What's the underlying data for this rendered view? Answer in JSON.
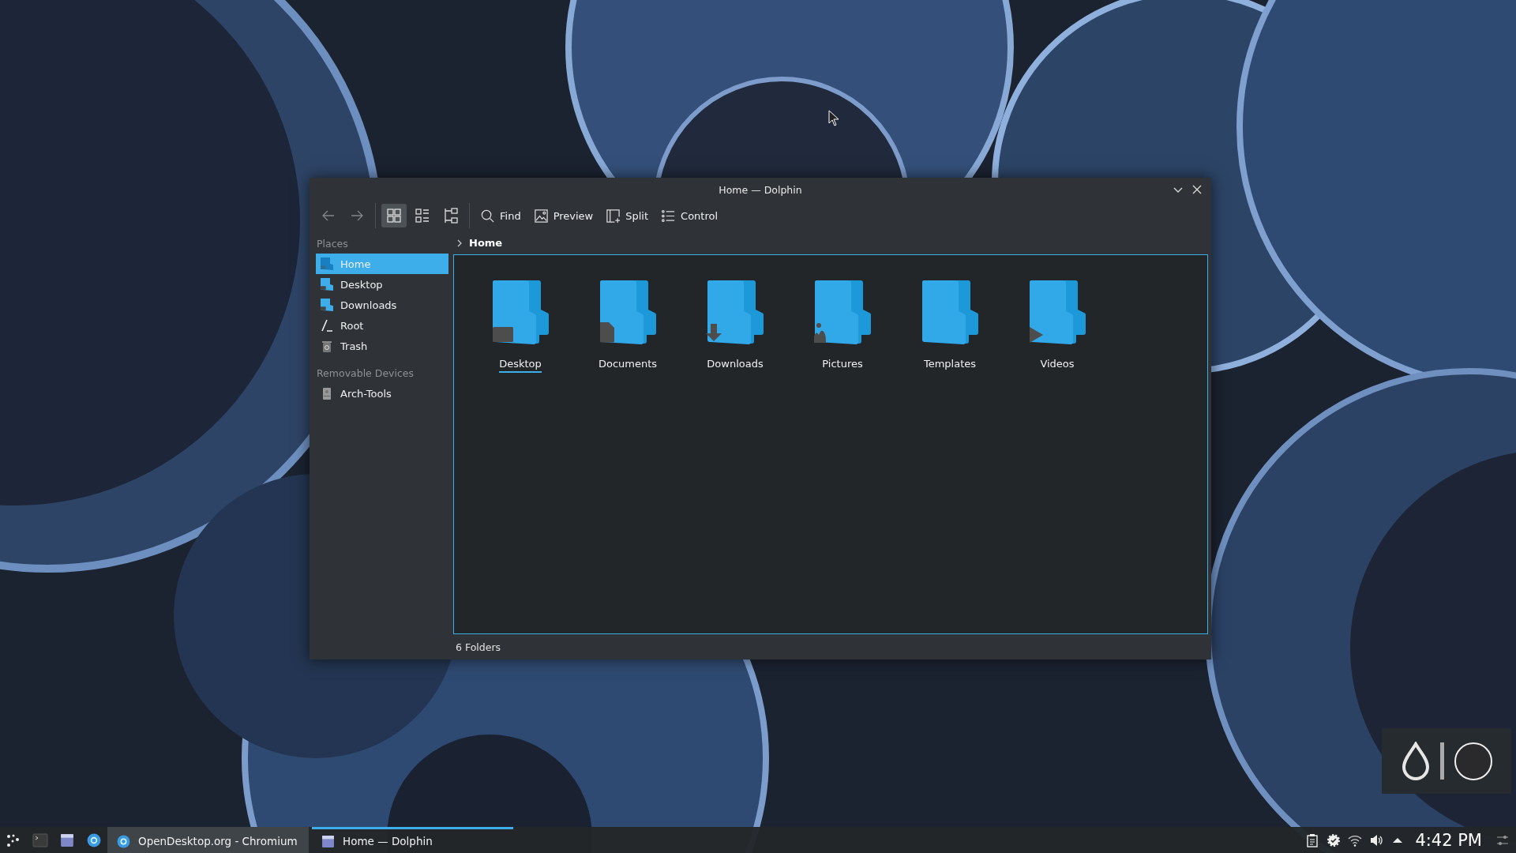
{
  "window": {
    "title": "Home — Dolphin"
  },
  "toolbar": {
    "view_modes": [
      {
        "kind": "icons",
        "selected": true
      },
      {
        "kind": "compact",
        "selected": false
      },
      {
        "kind": "details",
        "selected": false
      }
    ],
    "buttons": [
      {
        "label": "Find",
        "kind": "search"
      },
      {
        "label": "Preview",
        "kind": "preview"
      },
      {
        "label": "Split",
        "kind": "split"
      },
      {
        "label": "Control",
        "kind": "menu"
      }
    ]
  },
  "sidebar": {
    "sections": [
      {
        "title": "Places",
        "items": [
          {
            "label": "Home",
            "kind": "home",
            "selected": true
          },
          {
            "label": "Desktop",
            "kind": "desktop",
            "selected": false
          },
          {
            "label": "Downloads",
            "kind": "downloads",
            "selected": false
          },
          {
            "label": "Root",
            "kind": "root",
            "selected": false
          },
          {
            "label": "Trash",
            "kind": "trash",
            "selected": false
          }
        ]
      },
      {
        "title": "Removable Devices",
        "items": [
          {
            "label": "Arch-Tools",
            "kind": "drive",
            "selected": false
          }
        ]
      }
    ]
  },
  "breadcrumb": {
    "location": "Home"
  },
  "folders": [
    {
      "name": "Desktop",
      "kind": "desktop",
      "selected": true
    },
    {
      "name": "Documents",
      "kind": "documents",
      "selected": false
    },
    {
      "name": "Downloads",
      "kind": "downloads",
      "selected": false
    },
    {
      "name": "Pictures",
      "kind": "pictures",
      "selected": false
    },
    {
      "name": "Templates",
      "kind": "templates",
      "selected": false
    },
    {
      "name": "Videos",
      "kind": "videos",
      "selected": false
    }
  ],
  "status_bar": "6 Folders",
  "taskbar": {
    "tasks": [
      {
        "label": "OpenDesktop.org - Chromium",
        "kind": "browser",
        "selected": false
      },
      {
        "label": "Home — Dolphin",
        "kind": "files",
        "selected": true
      }
    ],
    "clock": "4:42 PM"
  }
}
